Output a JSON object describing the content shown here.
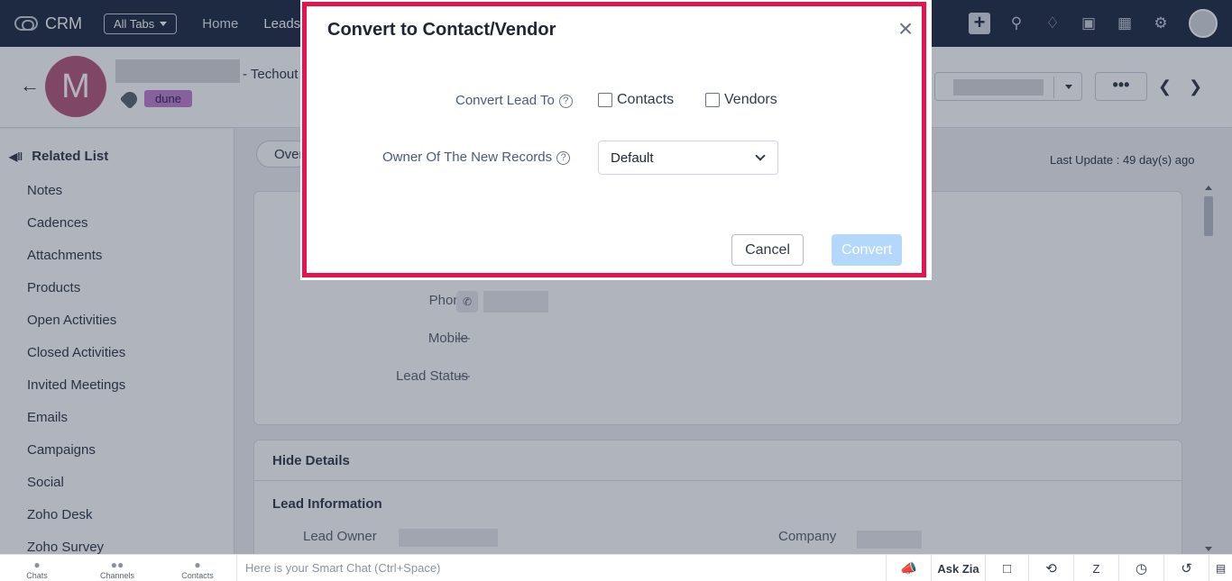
{
  "topnav": {
    "app_name": "CRM",
    "all_tabs_label": "All Tabs",
    "links": [
      "Home",
      "Leads"
    ]
  },
  "record": {
    "avatar_initial": "M",
    "company_suffix": "- Techout",
    "tag": "dune"
  },
  "sidebar": {
    "title": "Related List",
    "items": [
      "Notes",
      "Cadences",
      "Attachments",
      "Products",
      "Open Activities",
      "Closed Activities",
      "Invited Meetings",
      "Emails",
      "Campaigns",
      "Social",
      "Zoho Desk",
      "Zoho Survey"
    ]
  },
  "main": {
    "overview_tab": "Overview",
    "last_update": "Last Update : 49 day(s) ago",
    "fields": {
      "phone_label": "Phone",
      "mobile_label": "Mobile",
      "mobile_value": "—",
      "lead_status_label": "Lead Status",
      "lead_status_value": "—"
    },
    "details": {
      "hide_details": "Hide Details",
      "section_title": "Lead Information",
      "lead_owner_label": "Lead Owner",
      "company_label": "Company"
    }
  },
  "footer": {
    "tabs": [
      "Chats",
      "Channels",
      "Contacts"
    ],
    "smart_chat_placeholder": "Here is your Smart Chat (Ctrl+Space)",
    "ask_zia": "Ask Zia"
  },
  "modal": {
    "title": "Convert to Contact/Vendor",
    "convert_lead_to_label": "Convert Lead To",
    "option_contacts": "Contacts",
    "option_vendors": "Vendors",
    "owner_label": "Owner Of The New Records",
    "owner_value": "Default",
    "cancel_label": "Cancel",
    "convert_label": "Convert"
  },
  "colors": {
    "highlight_border": "#e8124f",
    "convert_button_disabled": "#b3d8fc",
    "nav_background": "#1f2a44"
  }
}
